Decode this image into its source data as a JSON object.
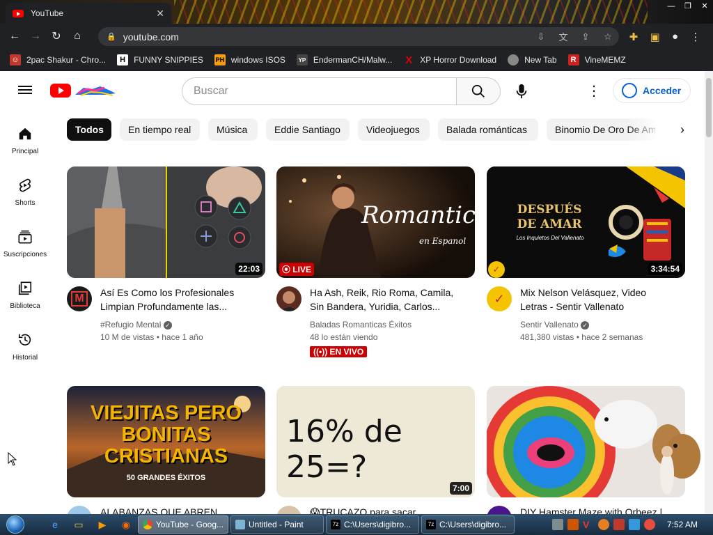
{
  "browser": {
    "tab_title": "YouTube",
    "url": "youtube.com",
    "bookmarks": [
      {
        "label": "2pac Shakur - Chro...",
        "icon": "person-icon",
        "color": "#c0392b"
      },
      {
        "label": "FUNNY SNIPPIES",
        "icon": "H",
        "color": "#ffffff"
      },
      {
        "label": "windows ISOS",
        "icon": "PH",
        "color": "#f39c12"
      },
      {
        "label": "EndermanCH/Malw...",
        "icon": "YP",
        "color": "#444444"
      },
      {
        "label": "XP Horror Download",
        "icon": "X",
        "color": "#e00000"
      },
      {
        "label": "New Tab",
        "icon": "globe-icon",
        "color": "#aaaaaa"
      },
      {
        "label": "VineMEMZ",
        "icon": "R",
        "color": "#cc2222"
      }
    ]
  },
  "youtube": {
    "search_placeholder": "Buscar",
    "signin_label": "Acceder",
    "sidebar": [
      {
        "label": "Principal",
        "icon": "home-icon"
      },
      {
        "label": "Shorts",
        "icon": "shorts-icon"
      },
      {
        "label": "Suscripciones",
        "icon": "subscriptions-icon"
      },
      {
        "label": "Biblioteca",
        "icon": "library-icon"
      },
      {
        "label": "Historial",
        "icon": "history-icon"
      }
    ],
    "chips": [
      "Todos",
      "En tiempo real",
      "Música",
      "Eddie Santiago",
      "Videojuegos",
      "Balada románticas",
      "Binomio De Oro De América"
    ],
    "videos": [
      {
        "title_line1": "Así Es Como los Profesionales",
        "title_line2": "Limpian Profundamente las...",
        "channel": "#Refugio Mental",
        "verified": true,
        "views": "10 M de vistas",
        "age": "hace 1 año",
        "duration": "22:03"
      },
      {
        "title_line1": "Ha Ash, Reik, Rio Roma, Camila,",
        "title_line2": "Sin Bandera, Yuridia, Carlos...",
        "channel": "Baladas Romanticas Éxitos",
        "verified": false,
        "views": "48 lo están viendo",
        "age": "",
        "duration": "",
        "live_badge": "LIVE",
        "live_label": "EN VIVO",
        "thumb_text": "Romanticas",
        "thumb_sub": "en Espanol"
      },
      {
        "title_line1": "Mix Nelson Velásquez, Video",
        "title_line2": "Letras - Sentir Vallenato",
        "channel": "Sentir Vallenato",
        "verified": true,
        "views": "481,380 vistas",
        "age": "hace 2 semanas",
        "duration": "3:34:54",
        "thumb_text1": "DESPUÉS",
        "thumb_text2": "DE AMAR",
        "thumb_sub": "Los Inquietos Del Vallenato"
      },
      {
        "title_line1": "ALABANZAS QUE ABREN",
        "thumb_text1": "VIEJITAS PERO",
        "thumb_text2": "BONITAS",
        "thumb_text3": "CRISTIANAS",
        "thumb_sub": "50 GRANDES ÉXITOS"
      },
      {
        "title_line1": "😱TRUCAZO para sacar",
        "duration": "7:00",
        "thumb_text": "16% de 25=?"
      },
      {
        "title_line1": "DIY Hamster Maze with Orbeez |"
      }
    ]
  },
  "taskbar": {
    "tasks": [
      "YouTube - Goog...",
      "Untitled - Paint",
      "C:\\Users\\digibro...",
      "C:\\Users\\digibro..."
    ],
    "clock": "7:52 AM"
  }
}
